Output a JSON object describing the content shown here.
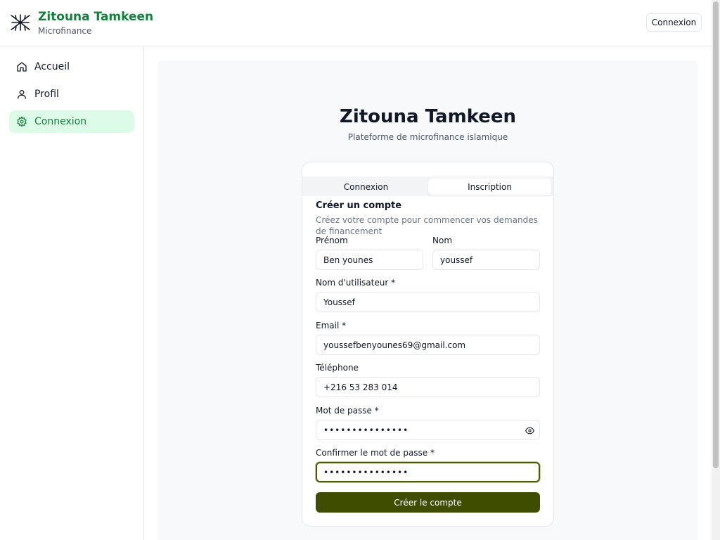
{
  "header": {
    "title": "Zitouna Tamkeen",
    "subtitle": "Microfinance",
    "login_button": "Connexion",
    "logo_icon": "tree-logo-icon"
  },
  "sidebar": {
    "items": [
      {
        "label": "Accueil",
        "icon": "home-icon"
      },
      {
        "label": "Profil",
        "icon": "user-icon"
      },
      {
        "label": "Connexion",
        "icon": "gear-icon",
        "active": true
      }
    ]
  },
  "main": {
    "title": "Zitouna Tamkeen",
    "subtitle": "Plateforme de microfinance islamique"
  },
  "auth": {
    "tabs": [
      {
        "label": "Connexion",
        "selected": false
      },
      {
        "label": "Inscription",
        "selected": true
      }
    ],
    "form_title": "Créer un compte",
    "form_description": "Créez votre compte pour commencer vos demandes de financement",
    "fields": {
      "first_name": {
        "label": "Prénom",
        "value": "Ben younes"
      },
      "last_name": {
        "label": "Nom",
        "value": "youssef"
      },
      "username": {
        "label": "Nom d'utilisateur *",
        "value": "Youssef"
      },
      "email": {
        "label": "Email *",
        "value": "youssefbenyounes69@gmail.com"
      },
      "phone": {
        "label": "Téléphone",
        "value": "+216 53 283 014"
      },
      "password": {
        "label": "Mot de passe *",
        "value": "•••••••••••••••"
      },
      "confirm_password": {
        "label": "Confirmer le mot de passe *",
        "value": "•••••••••••••••"
      }
    },
    "submit_label": "Créer le compte"
  },
  "colors": {
    "brand_green": "#15803d",
    "active_nav_bg": "#dcfce7",
    "submit_bg": "#3f4d00"
  }
}
